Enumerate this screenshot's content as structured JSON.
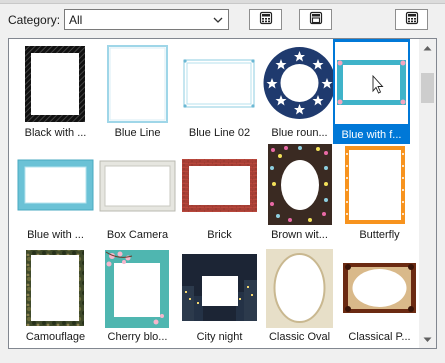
{
  "category": {
    "label": "Category:",
    "value": "All"
  },
  "toolbar_buttons": [
    {
      "icon": "calculator-icon"
    },
    {
      "icon": "save-frame-icon"
    },
    {
      "icon": "calculator-icon"
    }
  ],
  "gallery": {
    "items": [
      {
        "label": "Black with ...",
        "selected": false
      },
      {
        "label": "Blue Line",
        "selected": false
      },
      {
        "label": "Blue Line 02",
        "selected": false
      },
      {
        "label": "Blue roun...",
        "selected": false
      },
      {
        "label": "Blue with f...",
        "selected": true
      },
      {
        "label": "Blue with ...",
        "selected": false
      },
      {
        "label": "Box Camera",
        "selected": false
      },
      {
        "label": "Brick",
        "selected": false
      },
      {
        "label": "Brown wit...",
        "selected": false
      },
      {
        "label": "Butterfly",
        "selected": false
      },
      {
        "label": "Camouflage",
        "selected": false
      },
      {
        "label": "Cherry blo...",
        "selected": false
      },
      {
        "label": "City night",
        "selected": false
      },
      {
        "label": "Classic Oval",
        "selected": false
      },
      {
        "label": "Classical P...",
        "selected": false
      }
    ]
  },
  "colors": {
    "selection": "#0078d7"
  }
}
